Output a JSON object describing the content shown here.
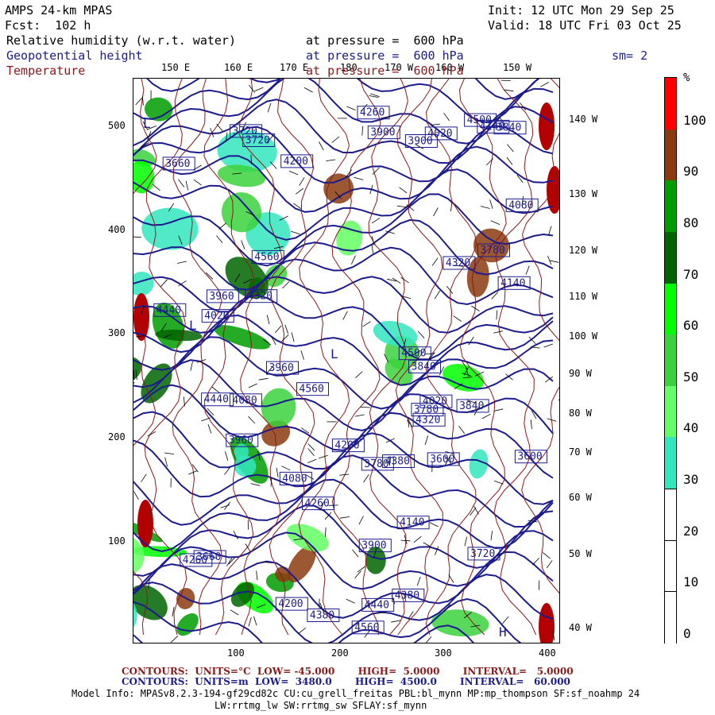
{
  "header": {
    "model": "AMPS 24-km MPAS",
    "fcst": "Fcst:  102 h",
    "init": "Init: 12 UTC Mon 29 Sep 25",
    "valid": "Valid: 18 UTC Fri 03 Oct 25"
  },
  "fields": [
    {
      "name": "Relative humidity (w.r.t. water)",
      "level": "at pressure =  600 hPa",
      "color": "#000000"
    },
    {
      "name": "Geopotential height",
      "level": "at pressure =  600 hPa",
      "color": "#1c1c8f"
    },
    {
      "name": "Temperature",
      "level": "at pressure =  600 hPa",
      "color": "#8b1a1a"
    }
  ],
  "smoothing": "sm= 2",
  "map": {
    "top_lon_labels": [
      "150 E",
      "160 E",
      "170 E",
      "180",
      "170 W",
      "160 W",
      "150 W"
    ],
    "right_lon_labels": [
      "140 W",
      "130 W",
      "120 W",
      "110 W",
      "100 W",
      "90 W",
      "80 W",
      "70 W",
      "60 W",
      "50 W",
      "40 W"
    ],
    "y_ticks": [
      "500",
      "400",
      "300",
      "200",
      "100"
    ],
    "x_ticks": [
      "100",
      "200",
      "300",
      "400"
    ],
    "height_labels": [
      "4260",
      "4320",
      "4200",
      "4140",
      "4080",
      "4020",
      "3960",
      "3900",
      "3840",
      "3780",
      "3720",
      "4560",
      "4440",
      "4380",
      "3600",
      "3660",
      "4500"
    ],
    "highs_lows": [
      "H",
      "L"
    ]
  },
  "colorbar": {
    "unit": "%",
    "labels": [
      "100",
      "90",
      "80",
      "70",
      "60",
      "50",
      "40",
      "30",
      "20",
      "10",
      "0"
    ],
    "colors": [
      "#ff0000",
      "#8b3a0f",
      "#009c00",
      "#006400",
      "#00ff00",
      "#3cd23c",
      "#64ff64",
      "#32e6be",
      "#ffffff",
      "#ffffff",
      "#ffffff"
    ]
  },
  "footer": {
    "temp_contours": "CONTOURS:  UNITS=°C  LOW= -45.000       HIGH=  5.0000       INTERVAL=   5.0000",
    "height_contours": "CONTOURS:  UNITS=m  LOW=  3480.0       HIGH=  4500.0       INTERVAL=   60.000",
    "model_info": "Model Info: MPASv8.2.3-194-gf29cd82c CU:cu_grell_freitas PBL:bl_mynn MP:mp_thompson SF:sf_noahmp 24",
    "model_info2": "LW:rrtmg_lw SW:rrtmg_sw SFLAY:sf_mynn"
  }
}
